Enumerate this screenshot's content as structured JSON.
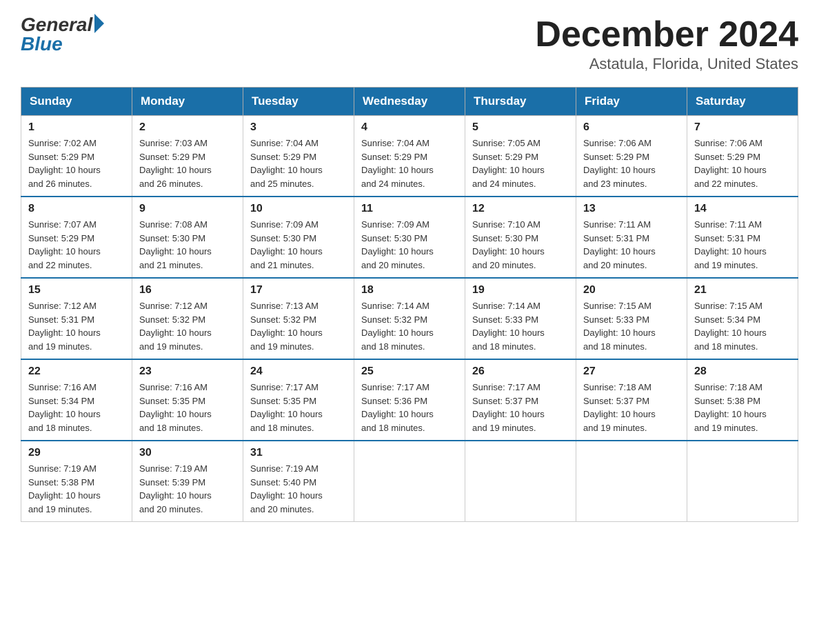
{
  "logo": {
    "general": "General",
    "blue": "Blue"
  },
  "title": "December 2024",
  "location": "Astatula, Florida, United States",
  "headers": [
    "Sunday",
    "Monday",
    "Tuesday",
    "Wednesday",
    "Thursday",
    "Friday",
    "Saturday"
  ],
  "weeks": [
    [
      {
        "day": "1",
        "sunrise": "7:02 AM",
        "sunset": "5:29 PM",
        "daylight": "10 hours and 26 minutes."
      },
      {
        "day": "2",
        "sunrise": "7:03 AM",
        "sunset": "5:29 PM",
        "daylight": "10 hours and 26 minutes."
      },
      {
        "day": "3",
        "sunrise": "7:04 AM",
        "sunset": "5:29 PM",
        "daylight": "10 hours and 25 minutes."
      },
      {
        "day": "4",
        "sunrise": "7:04 AM",
        "sunset": "5:29 PM",
        "daylight": "10 hours and 24 minutes."
      },
      {
        "day": "5",
        "sunrise": "7:05 AM",
        "sunset": "5:29 PM",
        "daylight": "10 hours and 24 minutes."
      },
      {
        "day": "6",
        "sunrise": "7:06 AM",
        "sunset": "5:29 PM",
        "daylight": "10 hours and 23 minutes."
      },
      {
        "day": "7",
        "sunrise": "7:06 AM",
        "sunset": "5:29 PM",
        "daylight": "10 hours and 22 minutes."
      }
    ],
    [
      {
        "day": "8",
        "sunrise": "7:07 AM",
        "sunset": "5:29 PM",
        "daylight": "10 hours and 22 minutes."
      },
      {
        "day": "9",
        "sunrise": "7:08 AM",
        "sunset": "5:30 PM",
        "daylight": "10 hours and 21 minutes."
      },
      {
        "day": "10",
        "sunrise": "7:09 AM",
        "sunset": "5:30 PM",
        "daylight": "10 hours and 21 minutes."
      },
      {
        "day": "11",
        "sunrise": "7:09 AM",
        "sunset": "5:30 PM",
        "daylight": "10 hours and 20 minutes."
      },
      {
        "day": "12",
        "sunrise": "7:10 AM",
        "sunset": "5:30 PM",
        "daylight": "10 hours and 20 minutes."
      },
      {
        "day": "13",
        "sunrise": "7:11 AM",
        "sunset": "5:31 PM",
        "daylight": "10 hours and 20 minutes."
      },
      {
        "day": "14",
        "sunrise": "7:11 AM",
        "sunset": "5:31 PM",
        "daylight": "10 hours and 19 minutes."
      }
    ],
    [
      {
        "day": "15",
        "sunrise": "7:12 AM",
        "sunset": "5:31 PM",
        "daylight": "10 hours and 19 minutes."
      },
      {
        "day": "16",
        "sunrise": "7:12 AM",
        "sunset": "5:32 PM",
        "daylight": "10 hours and 19 minutes."
      },
      {
        "day": "17",
        "sunrise": "7:13 AM",
        "sunset": "5:32 PM",
        "daylight": "10 hours and 19 minutes."
      },
      {
        "day": "18",
        "sunrise": "7:14 AM",
        "sunset": "5:32 PM",
        "daylight": "10 hours and 18 minutes."
      },
      {
        "day": "19",
        "sunrise": "7:14 AM",
        "sunset": "5:33 PM",
        "daylight": "10 hours and 18 minutes."
      },
      {
        "day": "20",
        "sunrise": "7:15 AM",
        "sunset": "5:33 PM",
        "daylight": "10 hours and 18 minutes."
      },
      {
        "day": "21",
        "sunrise": "7:15 AM",
        "sunset": "5:34 PM",
        "daylight": "10 hours and 18 minutes."
      }
    ],
    [
      {
        "day": "22",
        "sunrise": "7:16 AM",
        "sunset": "5:34 PM",
        "daylight": "10 hours and 18 minutes."
      },
      {
        "day": "23",
        "sunrise": "7:16 AM",
        "sunset": "5:35 PM",
        "daylight": "10 hours and 18 minutes."
      },
      {
        "day": "24",
        "sunrise": "7:17 AM",
        "sunset": "5:35 PM",
        "daylight": "10 hours and 18 minutes."
      },
      {
        "day": "25",
        "sunrise": "7:17 AM",
        "sunset": "5:36 PM",
        "daylight": "10 hours and 18 minutes."
      },
      {
        "day": "26",
        "sunrise": "7:17 AM",
        "sunset": "5:37 PM",
        "daylight": "10 hours and 19 minutes."
      },
      {
        "day": "27",
        "sunrise": "7:18 AM",
        "sunset": "5:37 PM",
        "daylight": "10 hours and 19 minutes."
      },
      {
        "day": "28",
        "sunrise": "7:18 AM",
        "sunset": "5:38 PM",
        "daylight": "10 hours and 19 minutes."
      }
    ],
    [
      {
        "day": "29",
        "sunrise": "7:19 AM",
        "sunset": "5:38 PM",
        "daylight": "10 hours and 19 minutes."
      },
      {
        "day": "30",
        "sunrise": "7:19 AM",
        "sunset": "5:39 PM",
        "daylight": "10 hours and 20 minutes."
      },
      {
        "day": "31",
        "sunrise": "7:19 AM",
        "sunset": "5:40 PM",
        "daylight": "10 hours and 20 minutes."
      },
      null,
      null,
      null,
      null
    ]
  ],
  "labels": {
    "sunrise": "Sunrise:",
    "sunset": "Sunset:",
    "daylight": "Daylight:"
  },
  "colors": {
    "header_bg": "#1a6fa8",
    "header_text": "#ffffff",
    "border": "#aaaaaa",
    "row_border": "#1a6fa8"
  }
}
